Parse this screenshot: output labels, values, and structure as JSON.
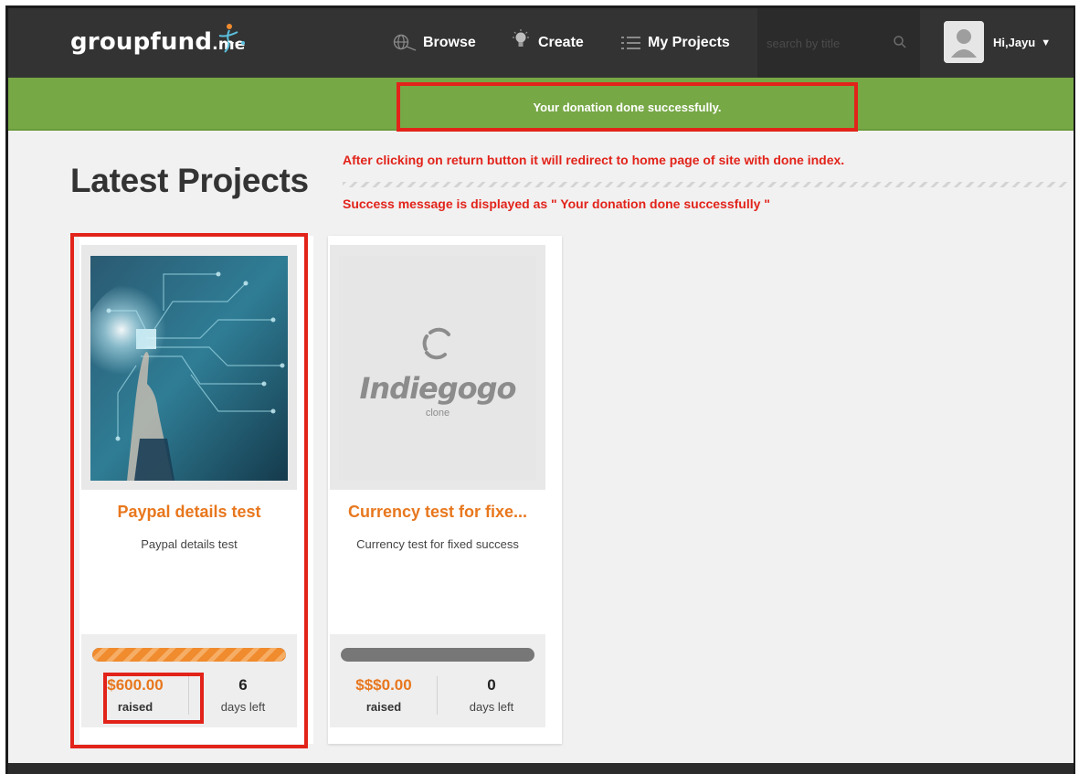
{
  "header": {
    "logo_main": "groupfund",
    "logo_tld": ".me",
    "nav": {
      "browse": "Browse",
      "create": "Create",
      "my_projects": "My Projects"
    },
    "search_placeholder": "search by title",
    "user_greeting": "Hi,Jayu"
  },
  "banner": {
    "message": "Your donation done successfully."
  },
  "page_title": "Latest Projects",
  "annotations": {
    "line1": "After clicking on return button it will redirect to home page of site with done index.",
    "line2": "Success message is displayed as \" Your donation done successfully \""
  },
  "projects": [
    {
      "title": "Paypal details test",
      "description": "Paypal details test",
      "amount": "$600.00",
      "amount_label": "raised",
      "days": "6",
      "days_label": "days left",
      "progress": 1.0,
      "image": "circuit-hand-photo"
    },
    {
      "title": "Currency test for fixe...",
      "description": "Currency test for fixed success",
      "amount": "$$$0.00",
      "amount_label": "raised",
      "days": "0",
      "days_label": "days left",
      "progress": 0.0,
      "image_brand": "Indiegogo",
      "image_sub": "clone"
    }
  ],
  "colors": {
    "header_bg": "#333333",
    "banner_bg": "#77a846",
    "accent_orange": "#e8771d",
    "annotation_red": "#e2231a"
  }
}
